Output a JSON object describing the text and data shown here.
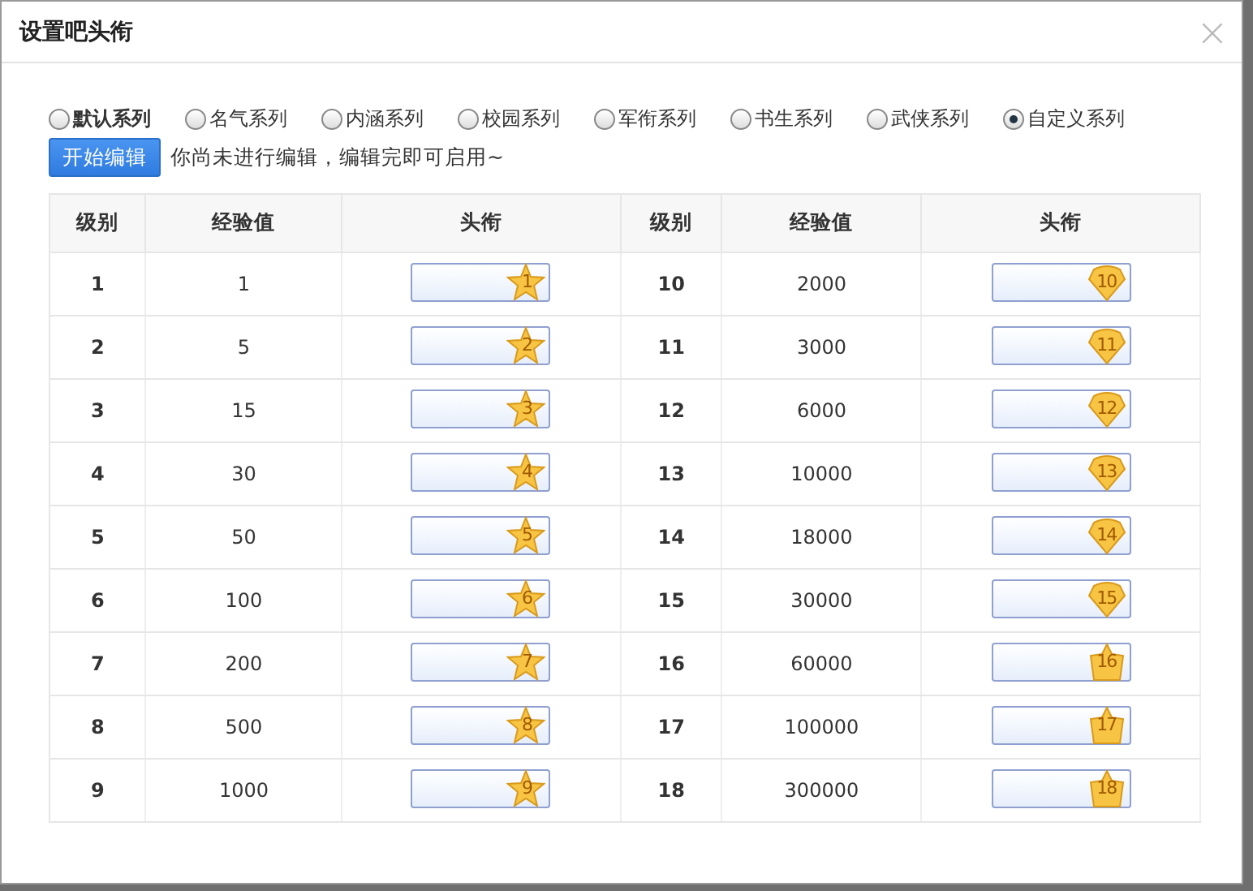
{
  "window": {
    "title": "设置吧头衔",
    "close": "×"
  },
  "series": [
    {
      "label": "默认系列",
      "selected": false,
      "bold": true
    },
    {
      "label": "名气系列",
      "selected": false,
      "bold": false
    },
    {
      "label": "内涵系列",
      "selected": false,
      "bold": false
    },
    {
      "label": "校园系列",
      "selected": false,
      "bold": false
    },
    {
      "label": "军衔系列",
      "selected": false,
      "bold": false
    },
    {
      "label": "书生系列",
      "selected": false,
      "bold": false
    },
    {
      "label": "武侠系列",
      "selected": false,
      "bold": false
    },
    {
      "label": "自定义系列",
      "selected": true,
      "bold": false
    }
  ],
  "edit_button": "开始编辑",
  "hint": "你尚未进行编辑，编辑完即可启用~",
  "table": {
    "columns": [
      "级别",
      "经验值",
      "头衔",
      "级别",
      "经验值",
      "头衔"
    ],
    "left_rows": [
      {
        "level": "1",
        "exp": "1",
        "badge": {
          "kind": "star",
          "number": "1"
        }
      },
      {
        "level": "2",
        "exp": "5",
        "badge": {
          "kind": "star",
          "number": "2"
        }
      },
      {
        "level": "3",
        "exp": "15",
        "badge": {
          "kind": "star",
          "number": "3"
        }
      },
      {
        "level": "4",
        "exp": "30",
        "badge": {
          "kind": "star",
          "number": "4"
        }
      },
      {
        "level": "5",
        "exp": "50",
        "badge": {
          "kind": "star",
          "number": "5"
        }
      },
      {
        "level": "6",
        "exp": "100",
        "badge": {
          "kind": "star",
          "number": "6"
        }
      },
      {
        "level": "7",
        "exp": "200",
        "badge": {
          "kind": "star",
          "number": "7"
        }
      },
      {
        "level": "8",
        "exp": "500",
        "badge": {
          "kind": "star",
          "number": "8"
        }
      },
      {
        "level": "9",
        "exp": "1000",
        "badge": {
          "kind": "star",
          "number": "9"
        }
      }
    ],
    "right_rows": [
      {
        "level": "10",
        "exp": "2000",
        "badge": {
          "kind": "heart",
          "number": "10"
        }
      },
      {
        "level": "11",
        "exp": "3000",
        "badge": {
          "kind": "heart",
          "number": "11"
        }
      },
      {
        "level": "12",
        "exp": "6000",
        "badge": {
          "kind": "heart",
          "number": "12"
        }
      },
      {
        "level": "13",
        "exp": "10000",
        "badge": {
          "kind": "heart",
          "number": "13"
        }
      },
      {
        "level": "14",
        "exp": "18000",
        "badge": {
          "kind": "heart",
          "number": "14"
        }
      },
      {
        "level": "15",
        "exp": "30000",
        "badge": {
          "kind": "heart",
          "number": "15"
        }
      },
      {
        "level": "16",
        "exp": "60000",
        "badge": {
          "kind": "crown",
          "number": "16"
        }
      },
      {
        "level": "17",
        "exp": "100000",
        "badge": {
          "kind": "crown",
          "number": "17"
        }
      },
      {
        "level": "18",
        "exp": "300000",
        "badge": {
          "kind": "crown",
          "number": "18"
        }
      }
    ]
  }
}
